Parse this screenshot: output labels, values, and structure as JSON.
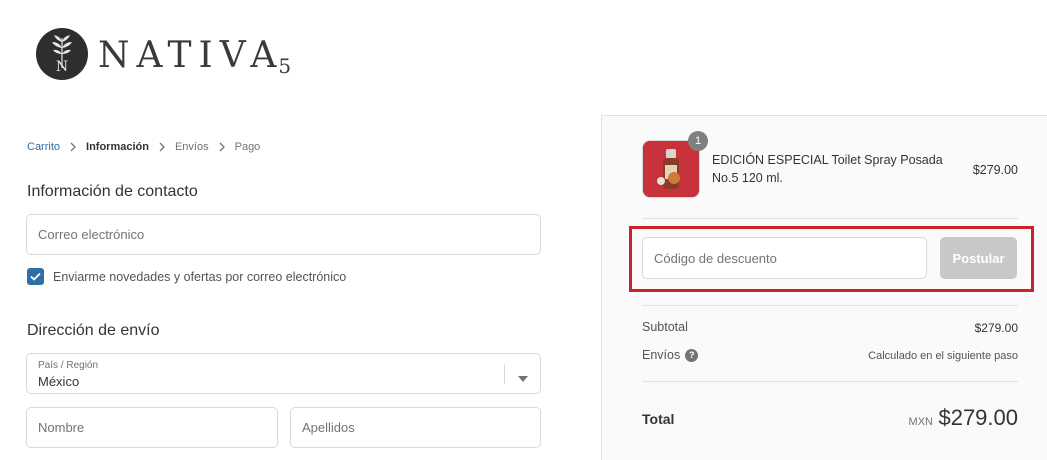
{
  "brand": {
    "name": "NATIVA",
    "suffix": "5",
    "mark": "N"
  },
  "breadcrumb": [
    {
      "label": "Carrito"
    },
    {
      "label": "Información"
    },
    {
      "label": "Envíos"
    },
    {
      "label": "Pago"
    }
  ],
  "contact": {
    "title": "Información de contacto",
    "email_placeholder": "Correo electrónico",
    "newsletter_label": "Enviarme novedades y ofertas por correo electrónico",
    "newsletter_checked": true
  },
  "shipping": {
    "title": "Dirección de envío",
    "country_label": "País / Región",
    "country_value": "México",
    "first_name_placeholder": "Nombre",
    "last_name_placeholder": "Apellidos"
  },
  "order": {
    "product": {
      "name": "EDICIÓN ESPECIAL Toilet Spray Posada No.5 120 ml.",
      "price": "$279.00",
      "quantity": "1"
    },
    "discount": {
      "placeholder": "Código de descuento",
      "button_label": "Postular"
    },
    "subtotal_label": "Subtotal",
    "subtotal_value": "$279.00",
    "shipping_label": "Envíos",
    "shipping_help": "?",
    "shipping_value": "Calculado en el siguiente paso",
    "total_label": "Total",
    "total_currency": "MXN",
    "total_value": "$279.00"
  },
  "colors": {
    "accent": "#2d6fa6",
    "highlight": "#c8222b",
    "button_disabled": "#c8c8c8",
    "sidebar_bg": "#fafafa"
  }
}
